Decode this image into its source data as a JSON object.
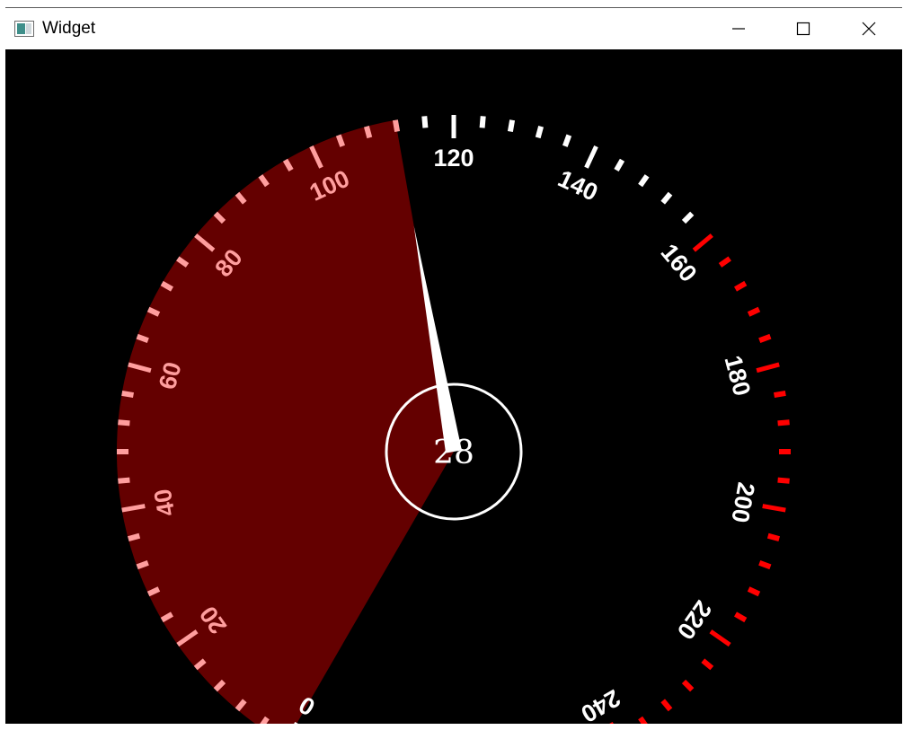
{
  "window": {
    "title": "Widget",
    "controls": {
      "minimize_icon": "minimize-icon",
      "maximize_icon": "maximize-icon",
      "close_icon": "close-icon"
    }
  },
  "gauge": {
    "value": 28,
    "value_label": "28",
    "min": 0,
    "max": 240,
    "major_step": 20,
    "minor_step": 4,
    "red_zone_start": 160,
    "scale_labels": [
      "0",
      "20",
      "40",
      "60",
      "80",
      "100",
      "120",
      "140",
      "160",
      "180",
      "200",
      "220",
      "240"
    ],
    "colors": {
      "background": "#000000",
      "progress_fill": "#640000",
      "tick_normal": "#ffffff",
      "tick_in_progress": "#ff9e9e",
      "tick_red_zone": "#ff0000",
      "needle": "#ffffff",
      "center_ring": "#ffffff"
    },
    "progress_fill_end_value": 112,
    "needle_value": 112
  }
}
